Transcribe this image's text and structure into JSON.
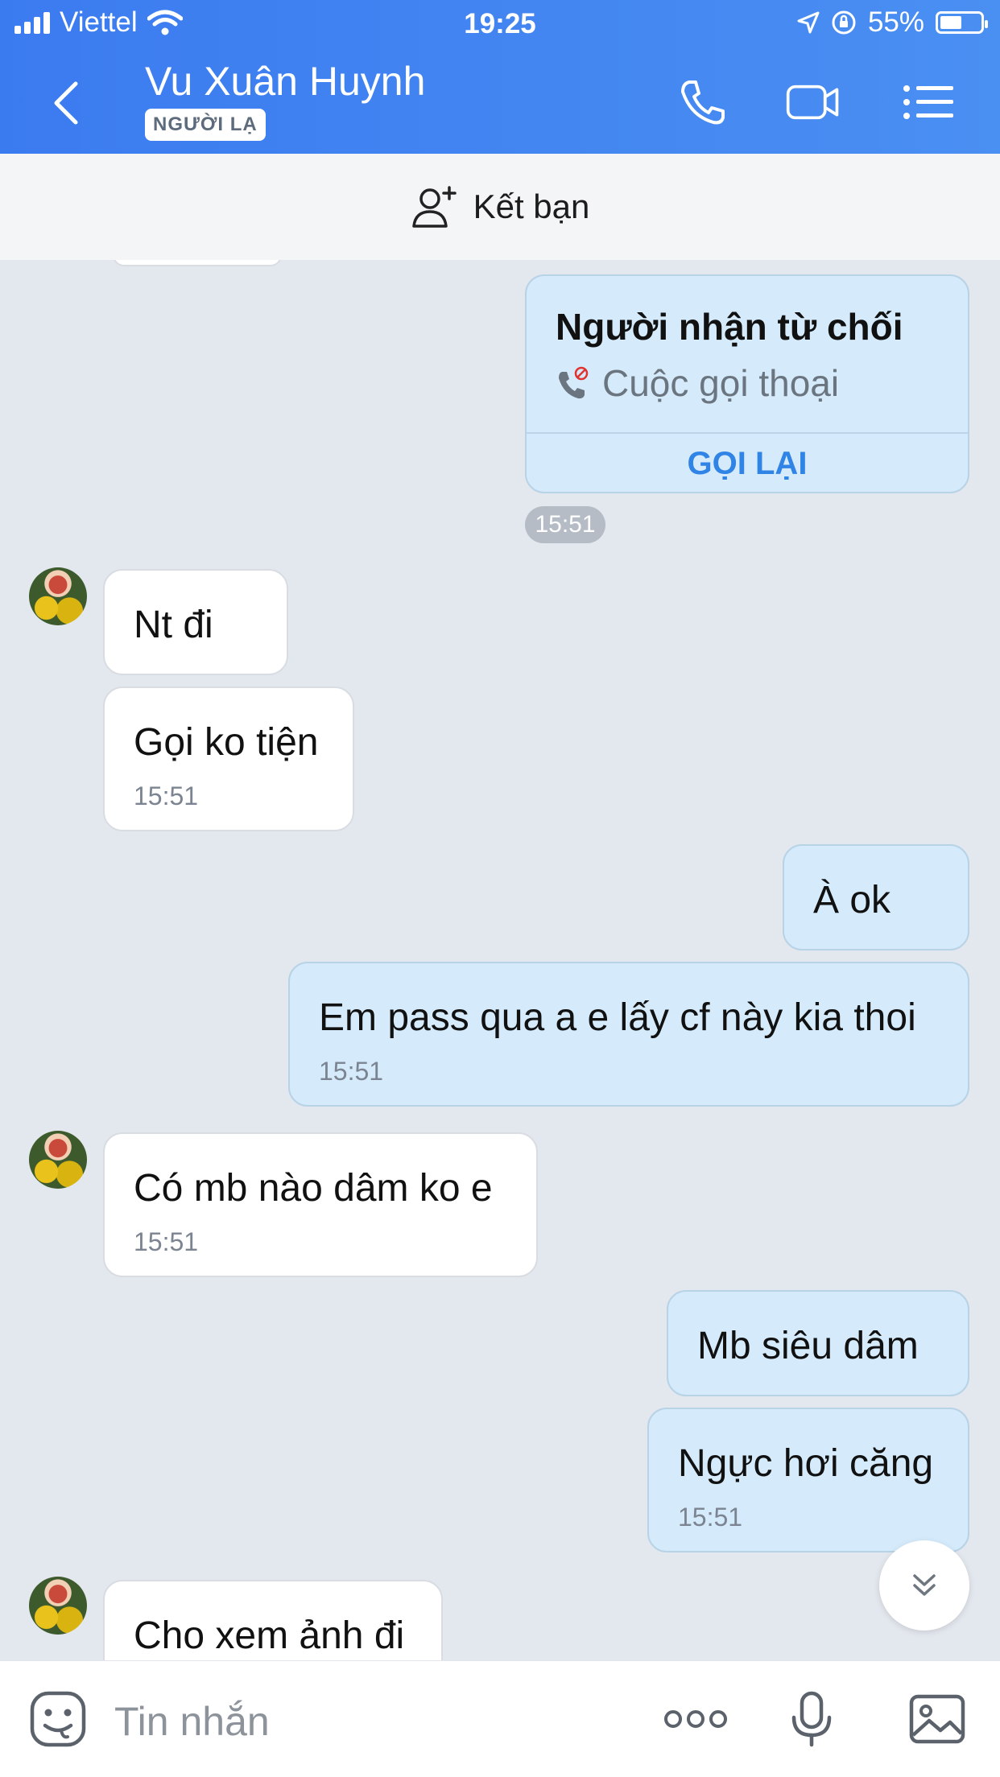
{
  "status": {
    "carrier": "Viettel",
    "time": "19:25",
    "battery": "55%"
  },
  "header": {
    "name": "Vu Xuân Huynh",
    "badge": "NGƯỜI LẠ"
  },
  "friend_bar": {
    "label": "Kết bạn"
  },
  "call_card": {
    "title": "Người nhận từ chối",
    "subtitle": "Cuộc gọi thoại",
    "action": "GỌI LẠI",
    "time": "15:51"
  },
  "messages": [
    {
      "text": "Nt đi",
      "time": ""
    },
    {
      "text": "Gọi ko tiện",
      "time": "15:51"
    },
    {
      "text": "À ok",
      "time": ""
    },
    {
      "text": "Em pass qua a e lấy cf này kia thoi",
      "time": "15:51"
    },
    {
      "text": "Có mb nào dâm ko e",
      "time": "15:51"
    },
    {
      "text": "Mb siêu dâm",
      "time": ""
    },
    {
      "text": "Ngực hơi căng",
      "time": "15:51"
    },
    {
      "text": "Cho xem ảnh đi",
      "time": ""
    }
  ],
  "input": {
    "placeholder": "Tin nhắn"
  }
}
